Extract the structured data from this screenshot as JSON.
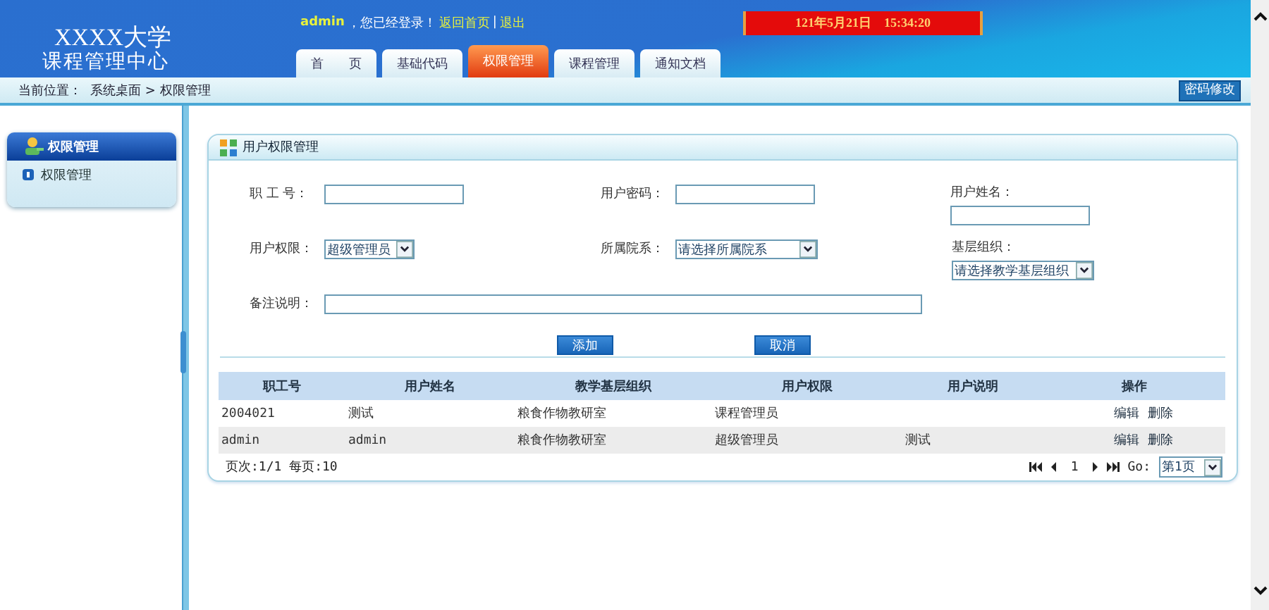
{
  "header": {
    "logo_line1": "XXXX大学",
    "logo_line2": "课程管理中心",
    "user": "admin",
    "login_text": "，您已经登录！",
    "home_link": "返回首页",
    "separator": "|",
    "logout_link": "退出",
    "clock": "121年5月21日　15:34:20"
  },
  "tabs": [
    {
      "label": "首　　页",
      "selected": false
    },
    {
      "label": "基础代码",
      "selected": false
    },
    {
      "label": "权限管理",
      "selected": true
    },
    {
      "label": "课程管理",
      "selected": false
    },
    {
      "label": "通知文档",
      "selected": false
    }
  ],
  "breadcrumb": {
    "label": "当前位置：",
    "path": "系统桌面 > 权限管理"
  },
  "password_button": "密码修改",
  "sidebar": {
    "title": "权限管理",
    "items": [
      {
        "label": "权限管理",
        "selected": false
      }
    ]
  },
  "panel": {
    "title": "用户权限管理",
    "form_rows": [
      [
        {
          "label": "职 工 号：",
          "kind": "input"
        },
        {
          "label": "用户密码：",
          "kind": "input"
        },
        {
          "label": "用户姓名：",
          "kind": "input"
        }
      ],
      [
        {
          "label": "用户权限：",
          "kind": "select",
          "value": "超级管理员"
        },
        {
          "label": "所属院系：",
          "kind": "select",
          "value": "请选择所属院系"
        },
        {
          "label": "基层组织：",
          "kind": "select",
          "value": "请选择教学基层组织"
        }
      ],
      [
        {
          "label": "备注说明：",
          "kind": "wide_input"
        }
      ]
    ],
    "buttons": [
      "添加",
      "取消"
    ],
    "table": {
      "columns": [
        "职工号",
        "用户姓名",
        "教学基层组织",
        "用户权限",
        "用户说明",
        "操作"
      ],
      "rows": [
        {
          "cells": [
            "2004021",
            "测试",
            "粮食作物教研室",
            "课程管理员",
            ""
          ],
          "actions": [
            "编辑",
            "删除"
          ]
        },
        {
          "cells": [
            "admin",
            "admin",
            "粮食作物教研室",
            "超级管理员",
            "测试"
          ],
          "actions": [
            "编辑",
            "删除"
          ]
        }
      ]
    },
    "pager": {
      "summary": "页次:1/1 每页:10",
      "page": "1",
      "go_label": "Go:",
      "go_value": "第1页"
    }
  }
}
